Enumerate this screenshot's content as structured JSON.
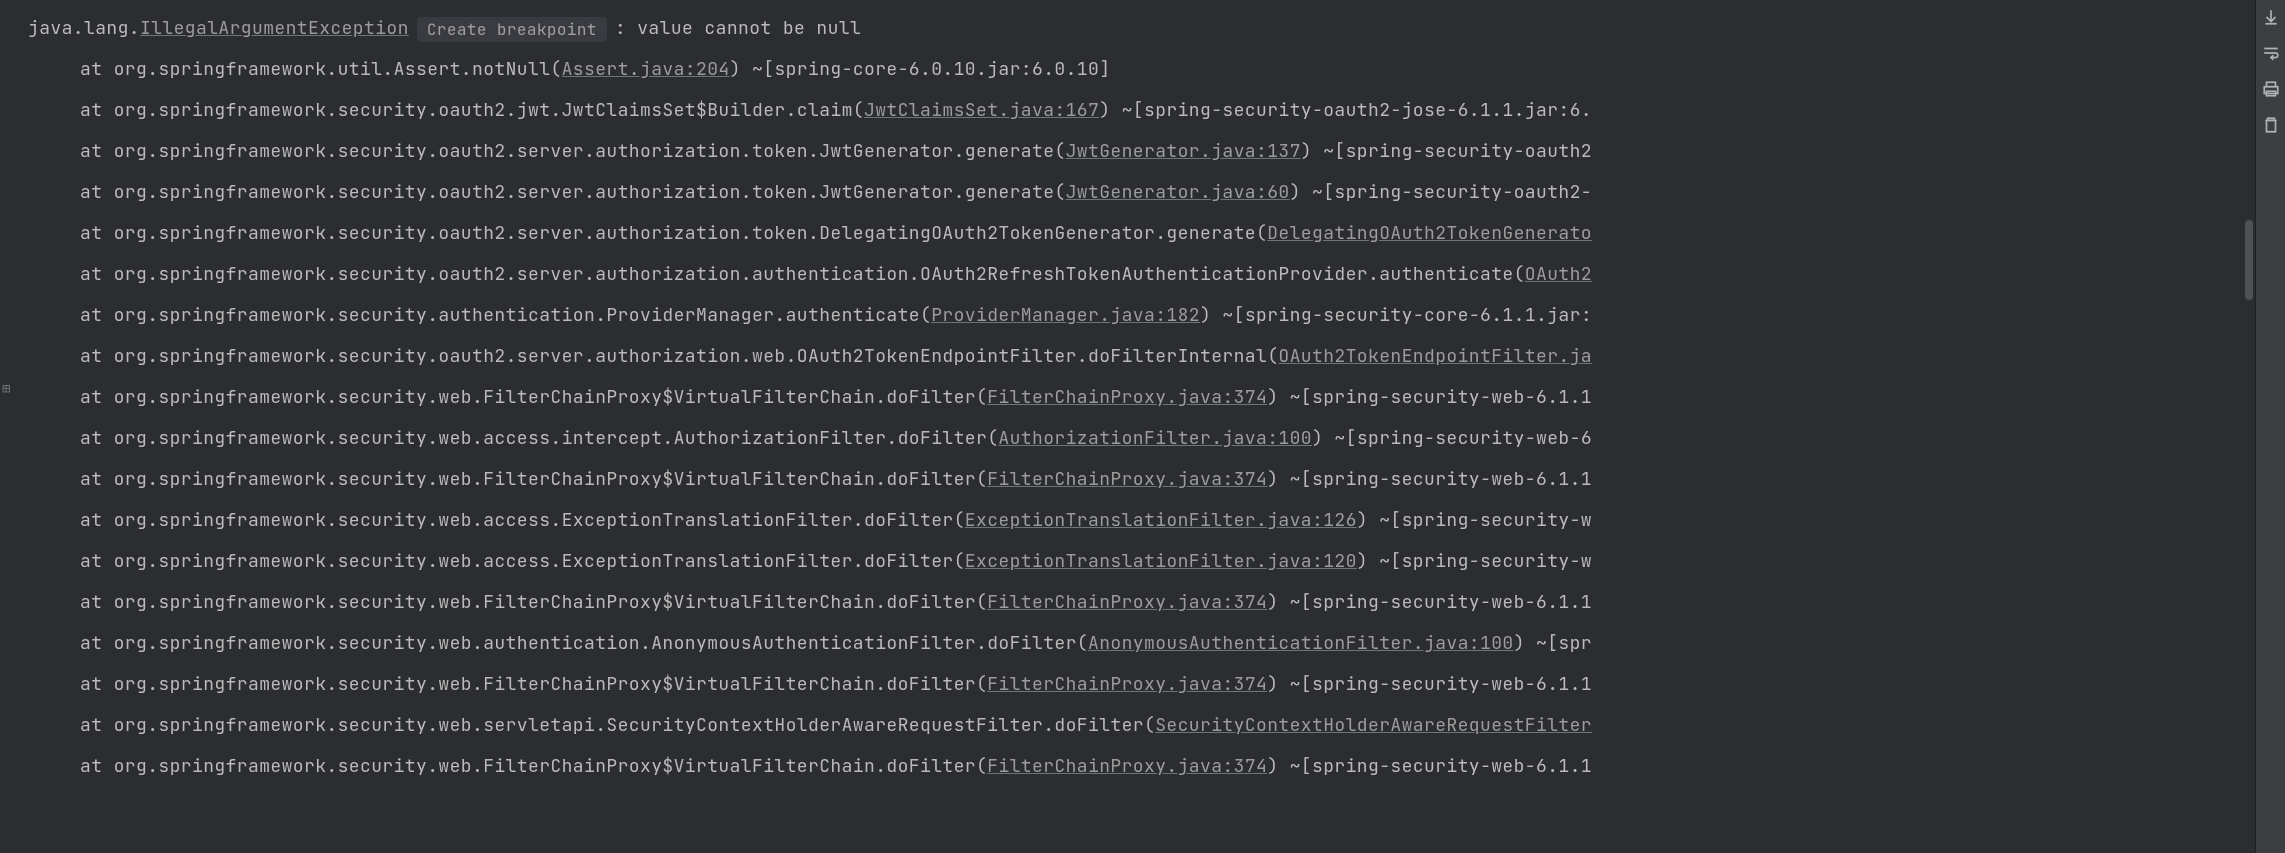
{
  "exception": {
    "prefix": "java.lang.",
    "class": "IllegalArgumentException",
    "inlay": "Create breakpoint",
    "message": ": value cannot be null"
  },
  "stack": [
    {
      "pre": "at org.springframework.util.Assert.notNull(",
      "link": "Assert.java:204",
      "post": ") ~[spring-core-6.0.10.jar:6.0.10]"
    },
    {
      "pre": "at org.springframework.security.oauth2.jwt.JwtClaimsSet$Builder.claim(",
      "link": "JwtClaimsSet.java:167",
      "post": ") ~[spring-security-oauth2-jose-6.1.1.jar:6."
    },
    {
      "pre": "at org.springframework.security.oauth2.server.authorization.token.JwtGenerator.generate(",
      "link": "JwtGenerator.java:137",
      "post": ") ~[spring-security-oauth2"
    },
    {
      "pre": "at org.springframework.security.oauth2.server.authorization.token.JwtGenerator.generate(",
      "link": "JwtGenerator.java:60",
      "post": ") ~[spring-security-oauth2-"
    },
    {
      "pre": "at org.springframework.security.oauth2.server.authorization.token.DelegatingOAuth2TokenGenerator.generate(",
      "link": "DelegatingOAuth2TokenGenerato",
      "post": ""
    },
    {
      "pre": "at org.springframework.security.oauth2.server.authorization.authentication.OAuth2RefreshTokenAuthenticationProvider.authenticate(",
      "link": "OAuth2",
      "post": ""
    },
    {
      "pre": "at org.springframework.security.authentication.ProviderManager.authenticate(",
      "link": "ProviderManager.java:182",
      "post": ") ~[spring-security-core-6.1.1.jar:"
    },
    {
      "pre": "at org.springframework.security.oauth2.server.authorization.web.OAuth2TokenEndpointFilter.doFilterInternal(",
      "link": "OAuth2TokenEndpointFilter.ja",
      "post": ""
    },
    {
      "pre": "at org.springframework.security.web.FilterChainProxy$VirtualFilterChain.doFilter(",
      "link": "FilterChainProxy.java:374",
      "post": ") ~[spring-security-web-6.1.1"
    },
    {
      "pre": "at org.springframework.security.web.access.intercept.AuthorizationFilter.doFilter(",
      "link": "AuthorizationFilter.java:100",
      "post": ") ~[spring-security-web-6"
    },
    {
      "pre": "at org.springframework.security.web.FilterChainProxy$VirtualFilterChain.doFilter(",
      "link": "FilterChainProxy.java:374",
      "post": ") ~[spring-security-web-6.1.1"
    },
    {
      "pre": "at org.springframework.security.web.access.ExceptionTranslationFilter.doFilter(",
      "link": "ExceptionTranslationFilter.java:126",
      "post": ") ~[spring-security-w"
    },
    {
      "pre": "at org.springframework.security.web.access.ExceptionTranslationFilter.doFilter(",
      "link": "ExceptionTranslationFilter.java:120",
      "post": ") ~[spring-security-w"
    },
    {
      "pre": "at org.springframework.security.web.FilterChainProxy$VirtualFilterChain.doFilter(",
      "link": "FilterChainProxy.java:374",
      "post": ") ~[spring-security-web-6.1.1"
    },
    {
      "pre": "at org.springframework.security.web.authentication.AnonymousAuthenticationFilter.doFilter(",
      "link": "AnonymousAuthenticationFilter.java:100",
      "post": ") ~[spr"
    },
    {
      "pre": "at org.springframework.security.web.FilterChainProxy$VirtualFilterChain.doFilter(",
      "link": "FilterChainProxy.java:374",
      "post": ") ~[spring-security-web-6.1.1"
    },
    {
      "pre": "at org.springframework.security.web.servletapi.SecurityContextHolderAwareRequestFilter.doFilter(",
      "link": "SecurityContextHolderAwareRequestFilter",
      "post": ""
    },
    {
      "pre": "at org.springframework.security.web.FilterChainProxy$VirtualFilterChain.doFilter(",
      "link": "FilterChainProxy.java:374",
      "post": ") ~[spring-security-web-6.1.1"
    }
  ],
  "gutter": {
    "expand": "⊞"
  }
}
